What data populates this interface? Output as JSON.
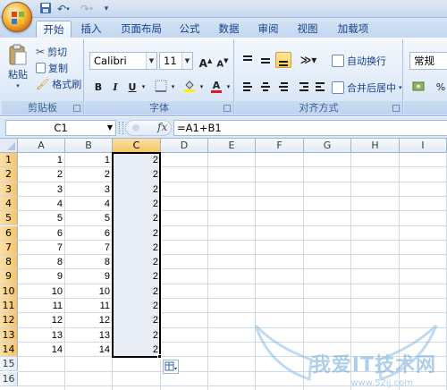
{
  "qat": {
    "save_icon": "save-icon",
    "undo_icon": "undo-icon",
    "redo_icon": "redo-icon",
    "customize": "▾"
  },
  "tabs": [
    {
      "label": "开始",
      "active": true
    },
    {
      "label": "插入"
    },
    {
      "label": "页面布局"
    },
    {
      "label": "公式"
    },
    {
      "label": "数据"
    },
    {
      "label": "审阅"
    },
    {
      "label": "视图"
    },
    {
      "label": "加载项"
    }
  ],
  "ribbon": {
    "clipboard": {
      "paste": "粘贴",
      "cut": "剪切",
      "copy": "复制",
      "format_painter": "格式刷",
      "label": "剪贴板"
    },
    "font": {
      "name": "Calibri",
      "size": "11",
      "bold": "B",
      "italic": "I",
      "underline": "U",
      "grow": "A",
      "shrink": "A",
      "label": "字体"
    },
    "alignment": {
      "wrap": "自动换行",
      "merge": "合并后居中",
      "label": "对齐方式"
    },
    "number": {
      "format": "常规",
      "percent": "%"
    }
  },
  "formula_bar": {
    "name_box": "C1",
    "fx": "fx",
    "formula": "=A1+B1"
  },
  "grid": {
    "columns": [
      "A",
      "B",
      "C",
      "D",
      "E",
      "F",
      "G",
      "H",
      "I"
    ],
    "selected_column": "C",
    "rows": [
      "1",
      "2",
      "3",
      "4",
      "5",
      "6",
      "7",
      "8",
      "9",
      "10",
      "11",
      "12",
      "13",
      "14",
      "15",
      "16"
    ],
    "data": [
      [
        "1",
        "1",
        "2"
      ],
      [
        "2",
        "2",
        "2"
      ],
      [
        "3",
        "3",
        "2"
      ],
      [
        "4",
        "4",
        "2"
      ],
      [
        "5",
        "5",
        "2"
      ],
      [
        "6",
        "6",
        "2"
      ],
      [
        "7",
        "7",
        "2"
      ],
      [
        "8",
        "8",
        "2"
      ],
      [
        "9",
        "9",
        "2"
      ],
      [
        "10",
        "10",
        "2"
      ],
      [
        "11",
        "11",
        "2"
      ],
      [
        "12",
        "12",
        "2"
      ],
      [
        "13",
        "13",
        "2"
      ],
      [
        "14",
        "14",
        "2"
      ]
    ]
  },
  "watermark": {
    "text": "我爱IT技术网",
    "url": "www.52ij.com"
  },
  "colors": {
    "selection_header": "#f7c566",
    "ribbon_text": "#15428b"
  }
}
